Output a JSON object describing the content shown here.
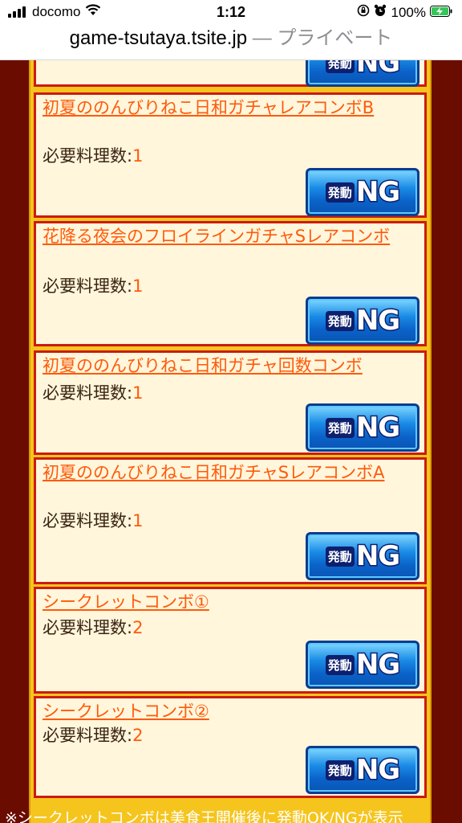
{
  "status": {
    "carrier": "docomo",
    "time": "1:12",
    "battery": "100%"
  },
  "address": {
    "domain": "game-tsutaya.tsite.jp",
    "suffix": "— プライベート"
  },
  "combos": [
    {
      "name": "",
      "req_label": "",
      "req_value": "",
      "button_kanji": "発動",
      "button_text": "NG"
    },
    {
      "name": "初夏ののんびりねこ日和ガチャレアコンボB",
      "req_label": "必要料理数:",
      "req_value": "1",
      "button_kanji": "発動",
      "button_text": "NG"
    },
    {
      "name": "花降る夜会のフロイラインガチャSレアコンボ",
      "req_label": "必要料理数:",
      "req_value": "1",
      "button_kanji": "発動",
      "button_text": "NG"
    },
    {
      "name": "初夏ののんびりねこ日和ガチャ回数コンボ",
      "req_label": "必要料理数:",
      "req_value": "1",
      "button_kanji": "発動",
      "button_text": "NG"
    },
    {
      "name": "初夏ののんびりねこ日和ガチャSレアコンボA",
      "req_label": "必要料理数:",
      "req_value": "1",
      "button_kanji": "発動",
      "button_text": "NG"
    },
    {
      "name": "シークレットコンボ①",
      "req_label": "必要料理数:",
      "req_value": "2",
      "button_kanji": "発動",
      "button_text": "NG"
    },
    {
      "name": "シークレットコンボ②",
      "req_label": "必要料理数:",
      "req_value": "2",
      "button_kanji": "発動",
      "button_text": "NG"
    }
  ],
  "footnote": "※シークレットコンボは美食王開催後に発動OK/NGが表示"
}
